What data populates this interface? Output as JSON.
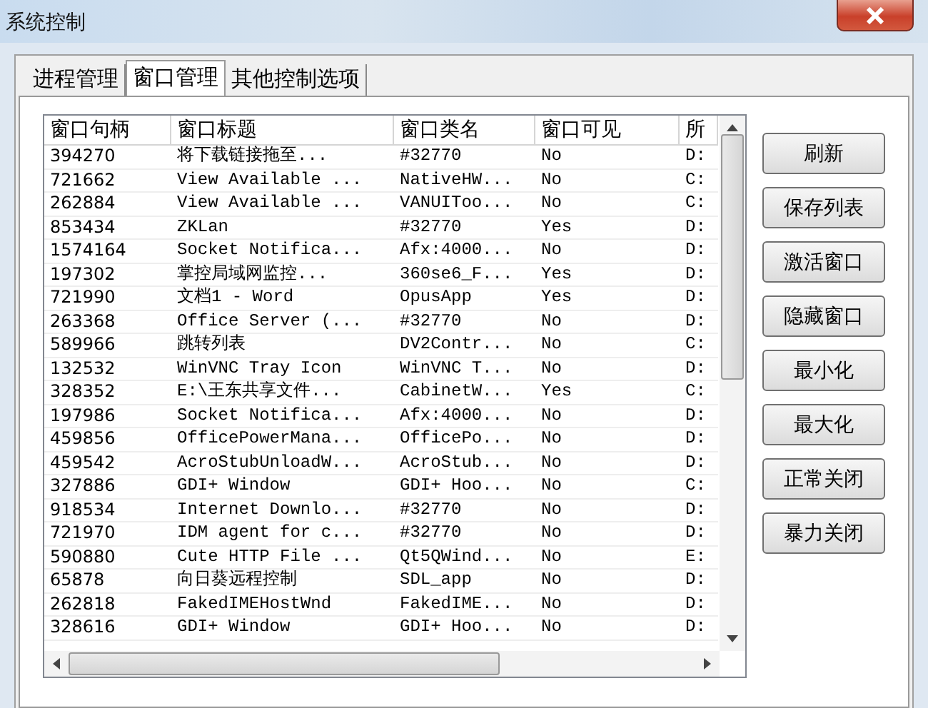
{
  "window": {
    "title": "系统控制"
  },
  "tabs": [
    {
      "label": "进程管理",
      "selected": false
    },
    {
      "label": "窗口管理",
      "selected": true
    },
    {
      "label": "其他控制选项",
      "selected": false
    }
  ],
  "table": {
    "columns": [
      "窗口句柄",
      "窗口标题",
      "窗口类名",
      "窗口可见",
      "所"
    ],
    "rows": [
      [
        "394270",
        "将下载链接拖至...",
        "#32770",
        "No",
        "D:"
      ],
      [
        "721662",
        "View Available ...",
        "NativeHW...",
        "No",
        "C:"
      ],
      [
        "262884",
        "View Available ...",
        "VANUIToo...",
        "No",
        "C:"
      ],
      [
        "853434",
        "ZKLan",
        "#32770",
        "Yes",
        "D:"
      ],
      [
        "1574164",
        "Socket Notifica...",
        "Afx:4000...",
        "No",
        "D:"
      ],
      [
        "197302",
        "掌控局域网监控...",
        "360se6_F...",
        "Yes",
        "D:"
      ],
      [
        "721990",
        "文档1 - Word",
        "OpusApp",
        "Yes",
        "D:"
      ],
      [
        "263368",
        "Office Server (...",
        "#32770",
        "No",
        "D:"
      ],
      [
        "589966",
        "跳转列表",
        "DV2Contr...",
        "No",
        "C:"
      ],
      [
        "132532",
        "WinVNC Tray Icon",
        "WinVNC T...",
        "No",
        "D:"
      ],
      [
        "328352",
        "E:\\王东共享文件...",
        "CabinetW...",
        "Yes",
        "C:"
      ],
      [
        "197986",
        "Socket Notifica...",
        "Afx:4000...",
        "No",
        "D:"
      ],
      [
        "459856",
        "OfficePowerMana...",
        "OfficePo...",
        "No",
        "D:"
      ],
      [
        "459542",
        "AcroStubUnloadW...",
        "AcroStub...",
        "No",
        "D:"
      ],
      [
        "327886",
        "GDI+ Window",
        "GDI+ Hoo...",
        "No",
        "C:"
      ],
      [
        "918534",
        "Internet Downlo...",
        "#32770",
        "No",
        "D:"
      ],
      [
        "721970",
        "IDM agent for c...",
        "#32770",
        "No",
        "D:"
      ],
      [
        "590880",
        "Cute HTTP File ...",
        "Qt5QWind...",
        "No",
        "E:"
      ],
      [
        "65878",
        "向日葵远程控制",
        "SDL_app",
        "No",
        "D:"
      ],
      [
        "262818",
        "FakedIMEHostWnd",
        "FakedIME...",
        "No",
        "D:"
      ],
      [
        "328616",
        "GDI+ Window",
        "GDI+ Hoo...",
        "No",
        "D:"
      ]
    ]
  },
  "buttons": [
    "刷新",
    "保存列表",
    "激活窗口",
    "隐藏窗口",
    "最小化",
    "最大化",
    "正常关闭",
    "暴力关闭"
  ]
}
